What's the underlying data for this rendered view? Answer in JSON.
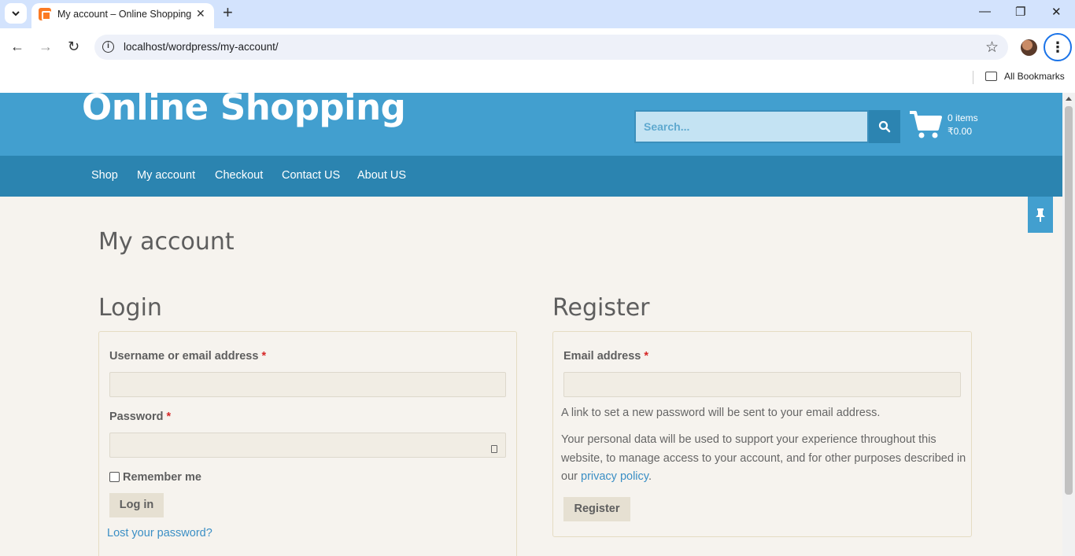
{
  "browser": {
    "tab_title": "My account – Online Shopping",
    "url": "localhost/wordpress/my-account/",
    "bookmarks_label": "All Bookmarks"
  },
  "site": {
    "title": "Online Shopping",
    "search_placeholder": "Search...",
    "cart_count": "0 items",
    "cart_total": "₹0.00",
    "nav": [
      "Shop",
      "My account",
      "Checkout",
      "Contact US",
      "About US"
    ]
  },
  "page": {
    "title": "My account"
  },
  "login": {
    "heading": "Login",
    "username_label": "Username or email address",
    "password_label": "Password",
    "required_mark": "*",
    "remember_label": "Remember me",
    "submit_label": "Log in",
    "lost_password": "Lost your password?"
  },
  "register": {
    "heading": "Register",
    "email_label": "Email address",
    "required_mark": "*",
    "note": "A link to set a new password will be sent to your email address.",
    "privacy_text_before": "Your personal data will be used to support your experience throughout this website, to manage access to your account, and for other purposes described in our ",
    "privacy_link": "privacy policy",
    "privacy_text_after": ".",
    "submit_label": "Register"
  },
  "colors": {
    "header_bg": "#429fcf",
    "nav_bg": "#2b84b0",
    "page_bg": "#f6f3ee",
    "link": "#3b8fc5"
  }
}
